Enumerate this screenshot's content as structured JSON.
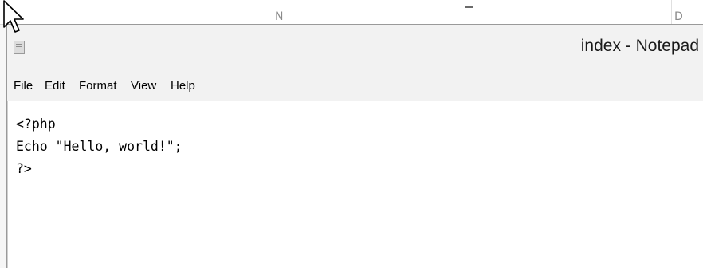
{
  "background_window": {
    "glyph_1": "N",
    "glyph_3": "D"
  },
  "window": {
    "title": "index - Notepad",
    "icon": "notepad-icon"
  },
  "menubar": {
    "items": [
      {
        "label": "File"
      },
      {
        "label": "Edit"
      },
      {
        "label": "Format"
      },
      {
        "label": "View"
      },
      {
        "label": "Help"
      }
    ]
  },
  "editor": {
    "lines": [
      "<?php",
      "Echo \"Hello, world!\";",
      "?>"
    ]
  },
  "cursor": {
    "icon": "arrow-pointer-icon"
  }
}
